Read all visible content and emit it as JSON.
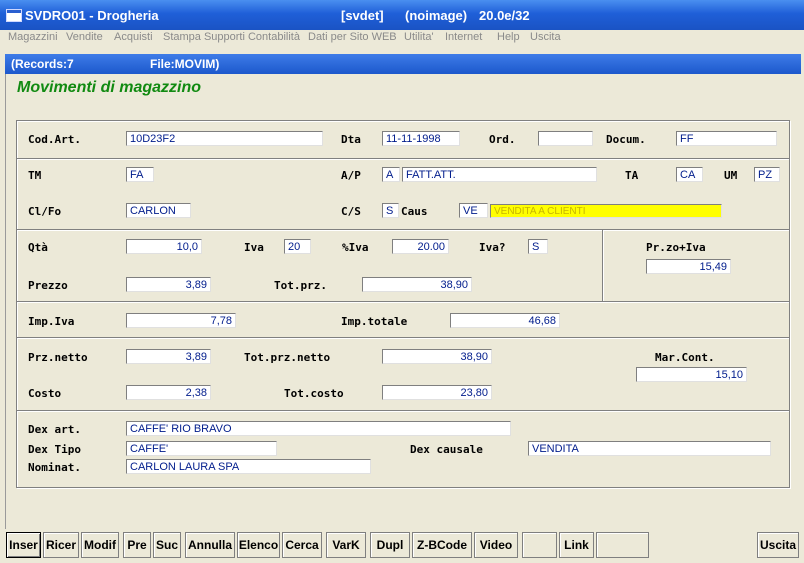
{
  "window": {
    "title": "SVDRO01 - Drogheria",
    "program": "[svdet]",
    "image": "(noimage)",
    "version": "20.0e/32"
  },
  "menu": [
    "Magazzini",
    "Vendite",
    "Acquisti",
    "Stampa Supporti Contabilità",
    "Dati per Sito WEB",
    "Utilita'",
    "Internet",
    "Help",
    "Uscita"
  ],
  "infobar": {
    "records": "(Records:7",
    "file": "File:MOVIM)"
  },
  "form_title": "Movimenti di magazzino",
  "labels": {
    "cod_art": "Cod.Art.",
    "dta": "Dta",
    "ord": "Ord.",
    "docum": "Docum.",
    "tm": "TM",
    "ap": "A/P",
    "ta": "TA",
    "um": "UM",
    "clfo": "Cl/Fo",
    "cs": "C/S",
    "caus": "Caus",
    "qta": "Qtà",
    "iva": "Iva",
    "piva": "%Iva",
    "ivaq": "Iva?",
    "przoiva": "Pr.zo+Iva",
    "prezzo": "Prezzo",
    "totprz": "Tot.prz.",
    "impiva": "Imp.Iva",
    "imptot": "Imp.totale",
    "prznetto": "Prz.netto",
    "totprznetto": "Tot.prz.netto",
    "marcont": "Mar.Cont.",
    "costo": "Costo",
    "totcosto": "Tot.costo",
    "dexart": "Dex art.",
    "dextipo": "Dex Tipo",
    "dexcaus": "Dex causale",
    "nominat": "Nominat."
  },
  "values": {
    "cod_art": "10D23F2",
    "dta": "11-11-1998",
    "ord": "",
    "docum": "FF",
    "tm": "FA",
    "ap": "A",
    "ap_desc": "FATT.ATT.",
    "ta": "CA",
    "um": "PZ",
    "clfo": "CARLON",
    "cs": "S",
    "caus": "VE",
    "caus_desc": "VENDITA A CLIENTI",
    "qta": "10,0",
    "iva": "20",
    "piva": "20.00",
    "ivaq": "S",
    "przoiva": "15,49",
    "prezzo": "3,89",
    "totprz": "38,90",
    "impiva": "7,78",
    "imptot": "46,68",
    "prznetto": "3,89",
    "totprznetto": "38,90",
    "marcont": "15,10",
    "costo": "2,38",
    "totcosto": "23,80",
    "dexart": "CAFFE' RIO BRAVO",
    "dextipo": "CAFFE'",
    "dexcaus": "VENDITA",
    "nominat": "CARLON LAURA SPA"
  },
  "buttons": [
    "Inser",
    "Ricer",
    "Modif",
    "Pre",
    "Suc",
    "Annulla",
    "Elenco",
    "Cerca",
    "VarK",
    "Dupl",
    "Z-BCode",
    "Video",
    "",
    "Link",
    "",
    "Uscita"
  ]
}
